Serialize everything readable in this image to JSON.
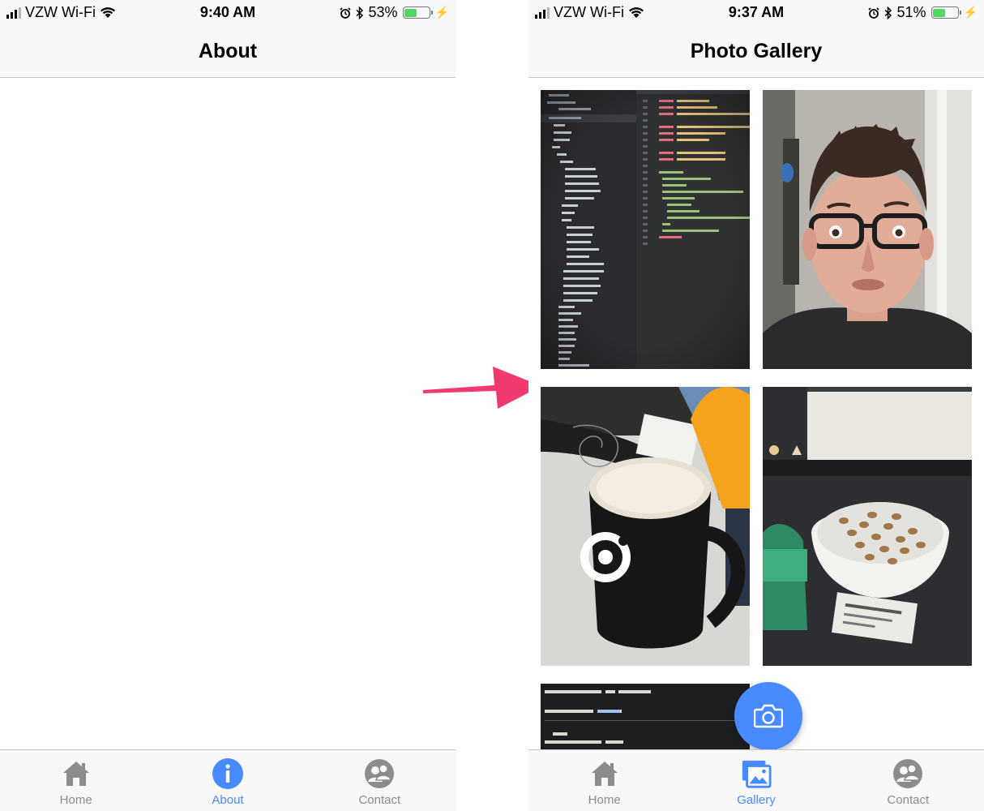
{
  "left_screen": {
    "status": {
      "carrier": "VZW Wi-Fi",
      "time": "9:40 AM",
      "battery": "53%",
      "battery_level": 0.53
    },
    "title": "About",
    "tabs": [
      {
        "label": "Home",
        "icon": "home-icon"
      },
      {
        "label": "About",
        "icon": "info-icon",
        "active": true
      },
      {
        "label": "Contact",
        "icon": "contact-icon"
      }
    ]
  },
  "right_screen": {
    "status": {
      "carrier": "VZW Wi-Fi",
      "time": "9:37 AM",
      "battery": "51%",
      "battery_level": 0.51
    },
    "title": "Photo Gallery",
    "photos": [
      "code-editor-screenshot",
      "selfie",
      "coffee-mug",
      "snack-bowl",
      "code-snippet"
    ],
    "fab": {
      "icon": "camera-icon"
    },
    "tabs": [
      {
        "label": "Home",
        "icon": "home-icon"
      },
      {
        "label": "Gallery",
        "icon": "images-icon",
        "active": true
      },
      {
        "label": "Contact",
        "icon": "contact-icon"
      }
    ]
  },
  "colors": {
    "accent": "#488aff",
    "inactive": "#8c8c8c",
    "arrow": "#f03a6e",
    "battery": "#4cd964"
  }
}
